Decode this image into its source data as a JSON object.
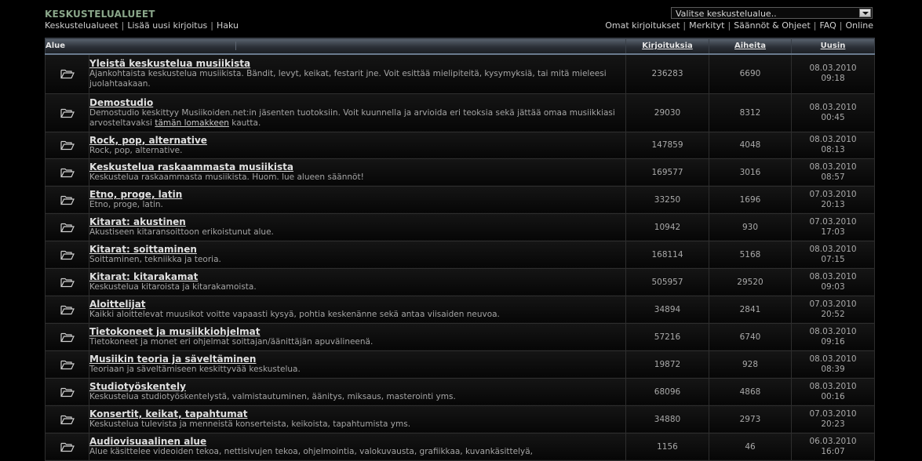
{
  "header": {
    "logo": "KESKUSTELUALUEET",
    "left_nav": [
      "Keskustelualueet",
      "Lisää uusi kirjoitus",
      "Haku"
    ],
    "right_nav": [
      "Omat kirjoitukset",
      "Merkityt",
      "Säännöt & Ohjeet",
      "FAQ",
      "Online"
    ],
    "separator": "|",
    "select_value": "Valitse keskustelualue.."
  },
  "table": {
    "columns": {
      "forum": "Alue",
      "posts": "Kirjoituksia",
      "topics": "Aiheita",
      "latest": "Uusin"
    },
    "rows": [
      {
        "name": "Yleistä keskustelua musiikista",
        "desc": "Ajankohtaista keskustelua musiikista. Bändit, levyt, keikat, festarit jne. Voit esittää mielipiteitä, kysymyksiä, tai mitä mieleesi juolahtaakaan.",
        "posts": "236283",
        "topics": "6690",
        "date": "08.03.2010",
        "time": "09:18"
      },
      {
        "name": "Demostudio",
        "desc": "Demostudio keskittyy Musiikoiden.net:in jäsenten tuotoksiin. Voit kuunnella ja arvioida eri teoksia sekä jättää omaa musiikkiasi arvosteltavaksi",
        "desc_link": "tämän lomakkeen",
        "desc_after": "kautta.",
        "posts": "29030",
        "topics": "8312",
        "date": "08.03.2010",
        "time": "00:45"
      },
      {
        "name": "Rock, pop, alternative",
        "desc": "Rock, pop, alternative.",
        "posts": "147859",
        "topics": "4048",
        "date": "08.03.2010",
        "time": "08:13"
      },
      {
        "name": "Keskustelua raskaammasta musiikista",
        "desc": "Keskustelua raskaammasta musiikista. Huom. lue alueen säännöt!",
        "posts": "169577",
        "topics": "3016",
        "date": "08.03.2010",
        "time": "08:57"
      },
      {
        "name": "Etno, proge, latin",
        "desc": "Etno, proge, latin.",
        "posts": "33250",
        "topics": "1696",
        "date": "07.03.2010",
        "time": "20:13"
      },
      {
        "name": "Kitarat: akustinen",
        "desc": "Akustiseen kitaransoittoon erikoistunut alue.",
        "posts": "10942",
        "topics": "930",
        "date": "07.03.2010",
        "time": "17:03"
      },
      {
        "name": "Kitarat: soittaminen",
        "desc": "Soittaminen, tekniikka ja teoria.",
        "posts": "168114",
        "topics": "5168",
        "date": "08.03.2010",
        "time": "07:15"
      },
      {
        "name": "Kitarat: kitarakamat",
        "desc": "Keskustelua kitaroista ja kitarakamoista.",
        "posts": "505957",
        "topics": "29520",
        "date": "08.03.2010",
        "time": "09:03"
      },
      {
        "name": "Aloittelijat",
        "desc": "Kaikki aloittelevat muusikot voitte vapaasti kysyä, pohtia keskenänne sekä antaa viisaiden neuvoa.",
        "posts": "34894",
        "topics": "2841",
        "date": "07.03.2010",
        "time": "20:52"
      },
      {
        "name": "Tietokoneet ja musiikkiohjelmat",
        "desc": "Tietokoneet ja monet eri ohjelmat soittajan/äänittäjän apuvälineenä.",
        "posts": "57216",
        "topics": "6740",
        "date": "08.03.2010",
        "time": "09:16"
      },
      {
        "name": "Musiikin teoria ja säveltäminen",
        "desc": "Teoriaan ja säveltämiseen keskittyvää keskustelua.",
        "posts": "19872",
        "topics": "928",
        "date": "08.03.2010",
        "time": "08:39"
      },
      {
        "name": "Studiotyöskentely",
        "desc": "Keskustelua studiotyöskentelystä, valmistautuminen, äänitys, miksaus, masterointi yms.",
        "posts": "68096",
        "topics": "4868",
        "date": "08.03.2010",
        "time": "00:16"
      },
      {
        "name": "Konsertit, keikat, tapahtumat",
        "desc": "Keskustelua tulevista ja menneistä konserteista, keikoista, tapahtumista yms.",
        "posts": "34880",
        "topics": "2973",
        "date": "07.03.2010",
        "time": "20:23"
      },
      {
        "name": "Audiovisuaalinen alue",
        "desc": "Alue käsittelee videoiden tekoa, nettisivujen tekoa, ohjelmointia, valokuvausta, grafiikkaa, kuvankäsittelyä,",
        "posts": "1156",
        "topics": "46",
        "date": "06.03.2010",
        "time": "16:07"
      }
    ]
  }
}
